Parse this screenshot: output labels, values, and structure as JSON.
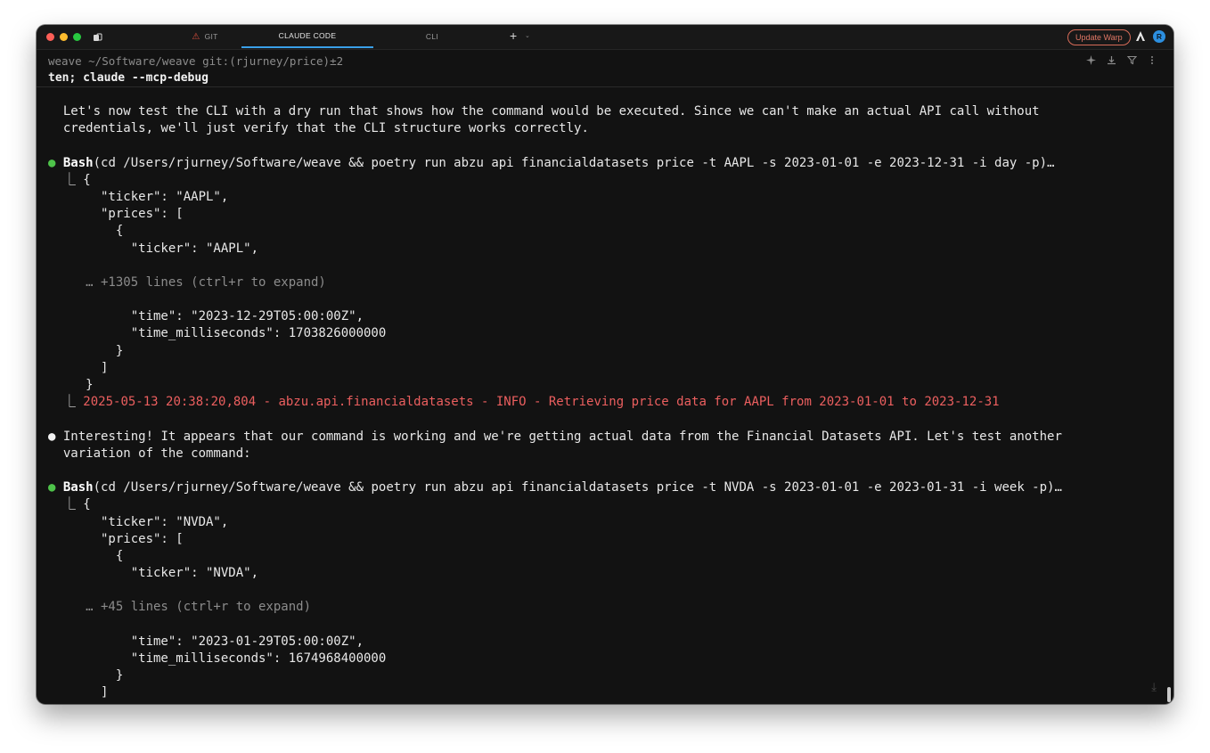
{
  "window": {
    "tabs": [
      {
        "label": "GIT",
        "icon": "warning-icon",
        "active": false
      },
      {
        "label": "CLAUDE CODE",
        "active": true
      },
      {
        "label": "CLI",
        "active": false
      }
    ],
    "new_tab_label": "+",
    "new_tab_caret": "⌄",
    "update_button": "Update Warp",
    "avatar_initial": "R",
    "accent_color": "#3aa0e8"
  },
  "block": {
    "prompt": "weave ~/Software/weave git:(rjurney/price)±2",
    "command": "ten; claude --mcp-debug"
  },
  "output": {
    "intro": [
      "  Let's now test the CLI with a dry run that shows how the command would be executed. Since we can't make an actual API call without",
      "  credentials, we'll just verify that the CLI structure works correctly."
    ],
    "tool1": {
      "bullet": "●",
      "name": "Bash",
      "args": "(cd /Users/rjurney/Software/weave && poetry run abzu api financialdatasets price -t AAPL -s 2023-01-01 -e 2023-12-31 -i day -p)…",
      "lines_head": [
        "  ⎿ {",
        "       \"ticker\": \"AAPL\",",
        "       \"prices\": [",
        "         {",
        "           \"ticker\": \"AAPL\","
      ],
      "collapsed": "     … +1305 lines (ctrl+r to expand)",
      "lines_tail": [
        "           \"time\": \"2023-12-29T05:00:00Z\",",
        "           \"time_milliseconds\": 1703826000000",
        "         }",
        "       ]",
        "     }"
      ],
      "stderr_prefix": "  ⎿ ",
      "stderr": "2025-05-13 20:38:20,804 - abzu.api.financialdatasets - INFO - Retrieving price data for AAPL from 2023-01-01 to 2023-12-31"
    },
    "message": {
      "bullet": "●",
      "lines": [
        " Interesting! It appears that our command is working and we're getting actual data from the Financial Datasets API. Let's test another",
        "  variation of the command:"
      ]
    },
    "tool2": {
      "bullet": "●",
      "name": "Bash",
      "args": "(cd /Users/rjurney/Software/weave && poetry run abzu api financialdatasets price -t NVDA -s 2023-01-01 -e 2023-01-31 -i week -p)…",
      "lines_head": [
        "  ⎿ {",
        "       \"ticker\": \"NVDA\",",
        "       \"prices\": [",
        "         {",
        "           \"ticker\": \"NVDA\","
      ],
      "collapsed": "     … +45 lines (ctrl+r to expand)",
      "lines_tail": [
        "           \"time\": \"2023-01-29T05:00:00Z\",",
        "           \"time_milliseconds\": 1674968400000",
        "         }",
        "       ]"
      ]
    },
    "colors": {
      "bullet_ok": "#4ec34a",
      "stderr": "#ec5f5f",
      "dim": "#8c8c8c"
    }
  }
}
